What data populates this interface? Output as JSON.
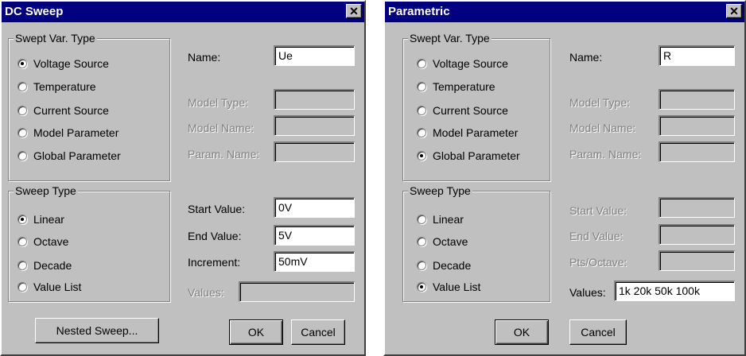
{
  "dc_sweep": {
    "title": "DC Sweep",
    "close_glyph": "✕",
    "swept_var_type": {
      "legend": "Swept Var. Type",
      "options": [
        {
          "label": "Voltage Source",
          "checked": true
        },
        {
          "label": "Temperature",
          "checked": false
        },
        {
          "label": "Current Source",
          "checked": false
        },
        {
          "label": "Model Parameter",
          "checked": false
        },
        {
          "label": "Global Parameter",
          "checked": false
        }
      ]
    },
    "name_label": "Name:",
    "name_value": "Ue",
    "model_type_label": "Model Type:",
    "model_name_label": "Model Name:",
    "param_name_label": "Param. Name:",
    "sweep_type": {
      "legend": "Sweep Type",
      "options": [
        {
          "label": "Linear",
          "checked": true
        },
        {
          "label": "Octave",
          "checked": false
        },
        {
          "label": "Decade",
          "checked": false
        },
        {
          "label": "Value List",
          "checked": false
        }
      ]
    },
    "start_value_label": "Start Value:",
    "start_value": "0V",
    "end_value_label": "End Value:",
    "end_value": "5V",
    "increment_label": "Increment:",
    "increment_value": "50mV",
    "values_label": "Values:",
    "nested_sweep_button": "Nested Sweep...",
    "ok_button": "OK",
    "cancel_button": "Cancel"
  },
  "parametric": {
    "title": "Parametric",
    "close_glyph": "✕",
    "swept_var_type": {
      "legend": "Swept Var. Type",
      "options": [
        {
          "label": "Voltage Source",
          "checked": false
        },
        {
          "label": "Temperature",
          "checked": false
        },
        {
          "label": "Current Source",
          "checked": false
        },
        {
          "label": "Model Parameter",
          "checked": false
        },
        {
          "label": "Global Parameter",
          "checked": true
        }
      ]
    },
    "name_label": "Name:",
    "name_value": "R",
    "model_type_label": "Model Type:",
    "model_name_label": "Model Name:",
    "param_name_label": "Param. Name:",
    "sweep_type": {
      "legend": "Sweep Type",
      "options": [
        {
          "label": "Linear",
          "checked": false
        },
        {
          "label": "Octave",
          "checked": false
        },
        {
          "label": "Decade",
          "checked": false
        },
        {
          "label": "Value List",
          "checked": true
        }
      ]
    },
    "start_value_label": "Start Value:",
    "end_value_label": "End Value:",
    "pts_octave_label": "Pts/Octave:",
    "values_label": "Values:",
    "values_value": "1k 20k 50k 100k",
    "ok_button": "OK",
    "cancel_button": "Cancel"
  }
}
